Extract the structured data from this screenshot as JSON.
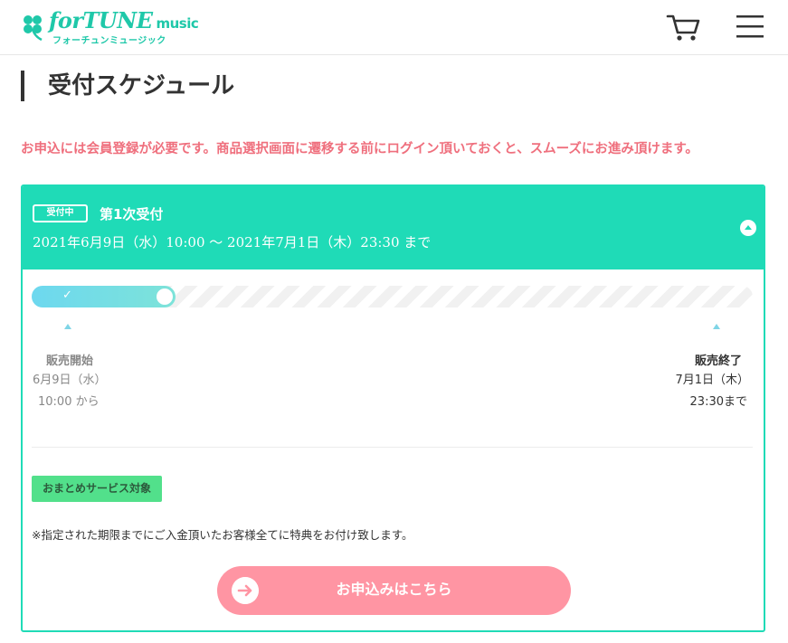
{
  "header": {
    "logo_main": "forTUNE",
    "logo_sub": "music",
    "logo_kana": "フォーチュンミュージック",
    "cart_icon": "cart-icon",
    "menu_icon": "hamburger-menu-icon"
  },
  "page": {
    "title": "受付スケジュール",
    "notice": "お申込には会員登録が必要です。商品選択画面に遷移する前にログイン頂いておくと、スムーズにお進み頂けます。"
  },
  "schedule": {
    "status_badge": "受付中",
    "round_title": "第1次受付",
    "period": "2021年6月9日（水）10:00 ～ 2021年7月1日（木）23:30 まで",
    "progress_fraction": 0.2,
    "start": {
      "label": "販売開始",
      "date": "6月9日（水）",
      "time": "10:00 から"
    },
    "end": {
      "label": "販売終了",
      "date": "7月1日（木）",
      "time": "23:30まで"
    },
    "service_tag": "おまとめサービス対象",
    "benefit_note": "※指定された期限までにご入金頂いたお客様全てに特典をお付け致します。",
    "apply_label": "お申込みはこちら"
  },
  "colors": {
    "brand": "#1fc8a9",
    "card_accent": "#1fdbb7",
    "notice": "#ef6f7d",
    "apply_button": "#ff95a3",
    "service_tag": "#52e08b"
  }
}
